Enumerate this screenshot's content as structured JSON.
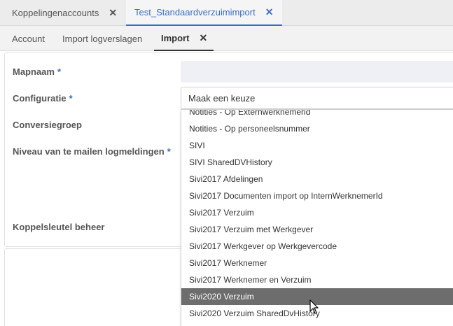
{
  "top_tabs": [
    {
      "label": "Koppelingenaccounts",
      "close": "✕"
    },
    {
      "label": "Test_Standaardverzuimimport",
      "close": "✕"
    }
  ],
  "sub_tabs": [
    {
      "label": "Account"
    },
    {
      "label": "Import logverslagen"
    },
    {
      "label": "Import",
      "close": "✕"
    }
  ],
  "form": {
    "mapnaam_label": "Mapnaam",
    "configuratie_label": "Configuratie",
    "conversiegroep_label": "Conversiegroep",
    "niveau_label": "Niveau van te mailen logmeldingen",
    "koppelsleutel_label": "Koppelsleutel beheer",
    "required_marker": "*",
    "configuratie_value": "Maak een keuze"
  },
  "dropdown": {
    "options": [
      "Notities - Op Externwerknemerid",
      "Notities - Op personeelsnummer",
      "SIVI",
      "SIVI SharedDVHistory",
      "Sivi2017 Afdelingen",
      "Sivi2017 Documenten import op InternWerknemerId",
      "Sivi2017 Verzuim",
      "Sivi2017 Verzuim met Werkgever",
      "Sivi2017 Werkgever op Werkgevercode",
      "Sivi2017 Werknemer",
      "Sivi2017 Werknemer en Verzuim",
      "Sivi2020 Verzuim",
      "Sivi2020 Verzuim SharedDvHistory"
    ],
    "selected": "Sivi2020 Verzuim"
  }
}
